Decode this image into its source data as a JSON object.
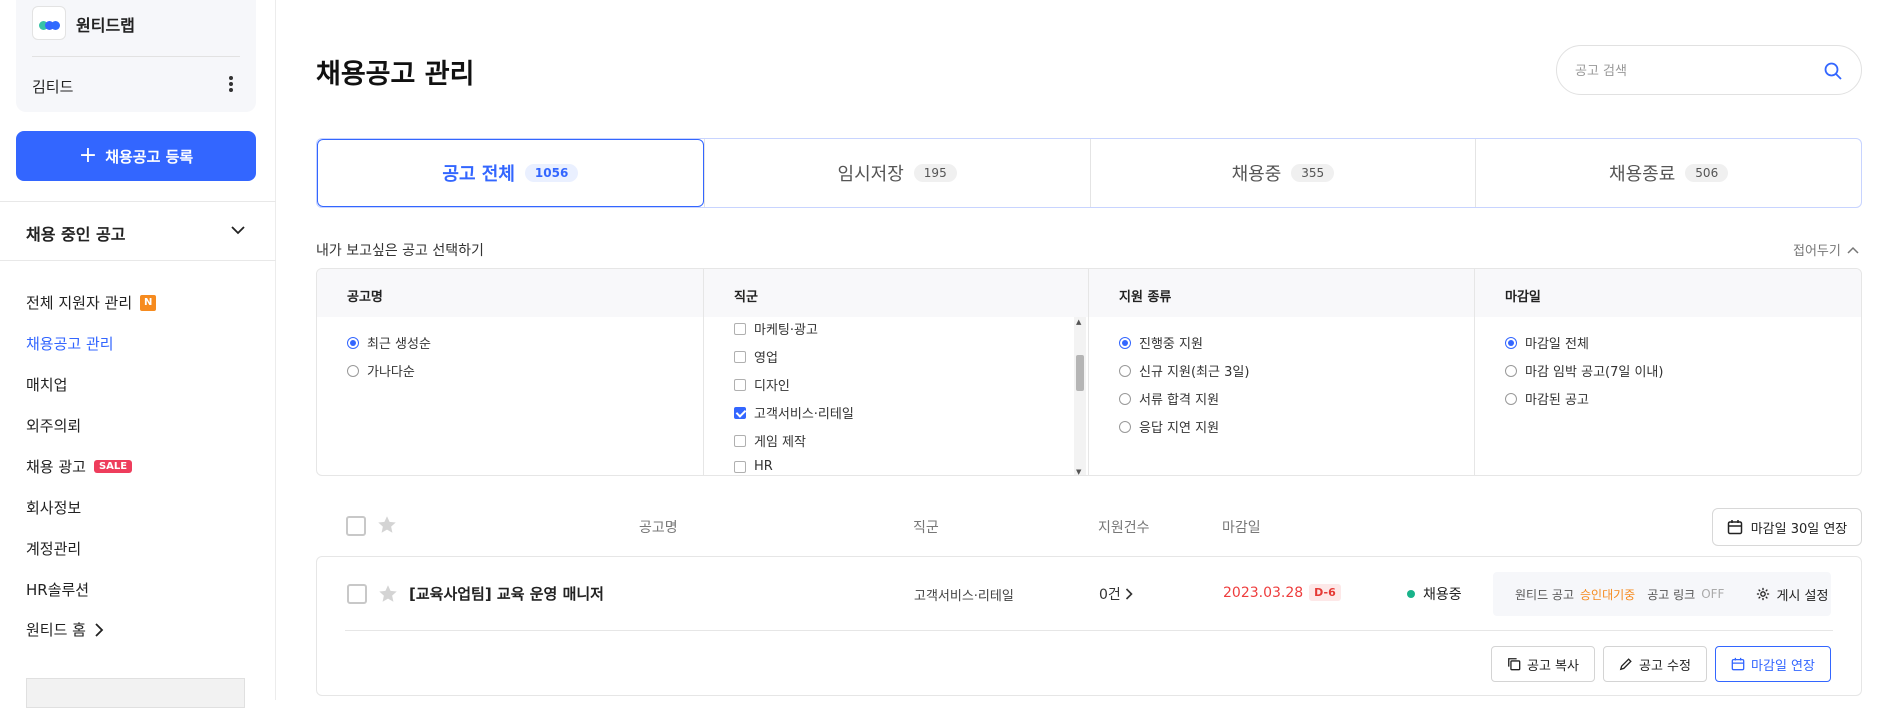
{
  "sidebar": {
    "company_name": "원티드랩",
    "user_name": "김티드",
    "register_button": "채용공고 등록",
    "section_title": "채용 중인 공고",
    "nav": [
      {
        "label": "전체 지원자 관리",
        "badge": "N"
      },
      {
        "label": "채용공고 관리"
      },
      {
        "label": "매치업"
      },
      {
        "label": "외주의뢰"
      },
      {
        "label": "채용 광고",
        "badge": "SALE"
      },
      {
        "label": "회사정보"
      },
      {
        "label": "계정관리"
      },
      {
        "label": "HR솔루션"
      },
      {
        "label": "원티드 홈"
      }
    ],
    "logo_colors": [
      "#36c3a7",
      "#3366ff",
      "#2f6bff"
    ]
  },
  "header": {
    "title": "채용공고 관리",
    "search_placeholder": "공고 검색"
  },
  "tabs": [
    {
      "label": "공고 전체",
      "count": "1056"
    },
    {
      "label": "임시저장",
      "count": "195"
    },
    {
      "label": "채용중",
      "count": "355"
    },
    {
      "label": "채용종료",
      "count": "506"
    }
  ],
  "filter": {
    "label": "내가 보고싶은 공고 선택하기",
    "collapse": "접어두기",
    "columns": [
      {
        "title": "공고명",
        "options": [
          "최근 생성순",
          "가나다순"
        ],
        "selected": "최근 생성순"
      },
      {
        "title": "직군",
        "options": [
          "마케팅·광고",
          "영업",
          "디자인",
          "고객서비스·리테일",
          "게임 제작",
          "HR"
        ],
        "checked": [
          "고객서비스·리테일"
        ]
      },
      {
        "title": "지원 종류",
        "options": [
          "진행중 지원",
          "신규 지원(최근 3일)",
          "서류 합격 지원",
          "응답 지연 지원"
        ],
        "selected": "진행중 지원"
      },
      {
        "title": "마감일",
        "options": [
          "마감일 전체",
          "마감 임박 공고(7일 이내)",
          "마감된 공고"
        ],
        "selected": "마감일 전체"
      }
    ]
  },
  "table": {
    "headers": {
      "title": "공고명",
      "job": "직군",
      "apps": "지원건수",
      "deadline": "마감일"
    },
    "extend_all": "마감일 30일 연장",
    "rows": [
      {
        "title": "[교육사업팀] 교육 운영 매니저",
        "job": "고객서비스·리테일",
        "applications": "0건",
        "deadline": "2023.03.28",
        "dday": "D-6",
        "status": "채용중",
        "post_label": "원티드 공고",
        "post_state": "승인대기중",
        "link_label": "공고 링크",
        "link_state": "OFF",
        "setting_label": "게시 설정",
        "actions": {
          "copy": "공고 복사",
          "edit": "공고 수정",
          "extend": "마감일 연장"
        }
      }
    ]
  },
  "colors": {
    "accent": "#3366ff",
    "danger": "#ee3d3d",
    "status_active": "#19b38a",
    "pending": "#f68b1f"
  }
}
